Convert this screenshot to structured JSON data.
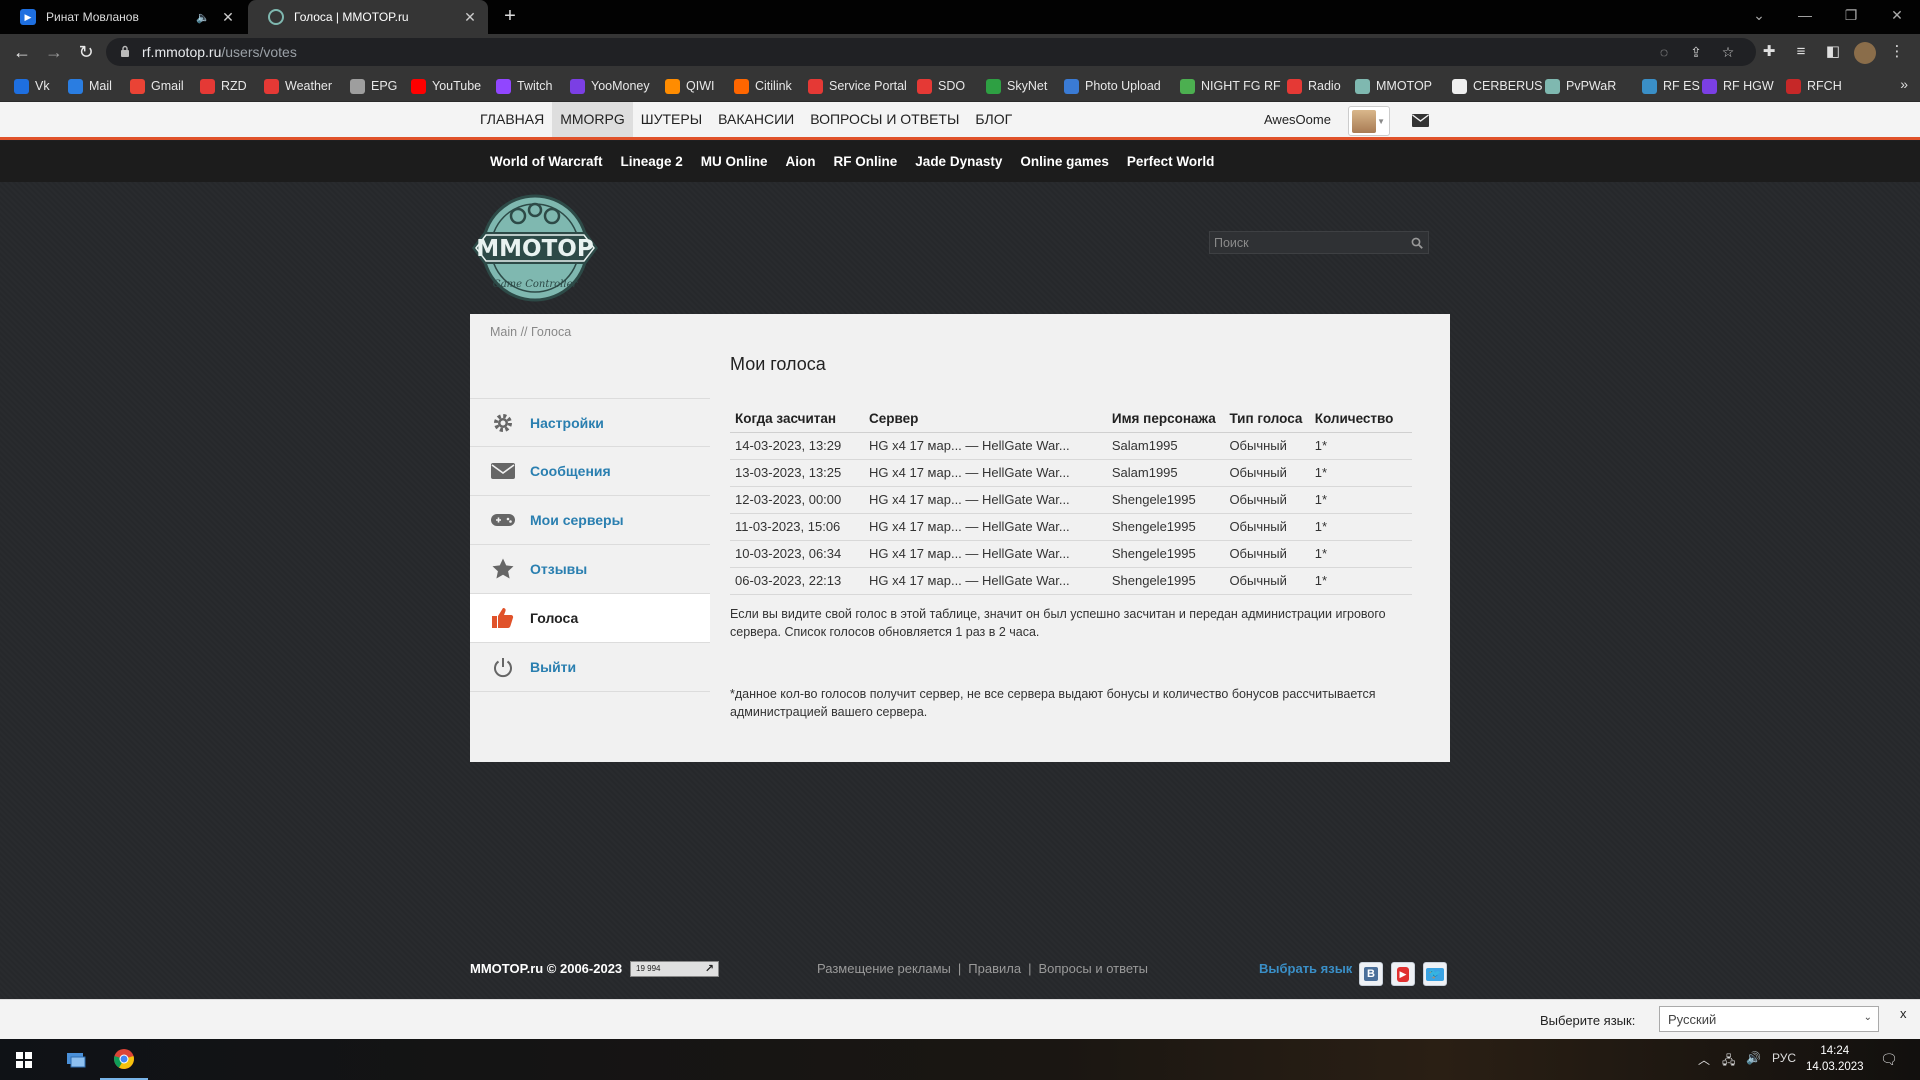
{
  "browser": {
    "tabs": [
      {
        "title": "Ринат Мовланов",
        "active": false,
        "muted": true
      },
      {
        "title": "Голоса | MMOTOP.ru",
        "active": true
      }
    ],
    "url_host": "rf.mmotop.ru",
    "url_path": "/users/votes",
    "bookmarks": [
      "Vk",
      "Mail",
      "Gmail",
      "RZD",
      "Weather",
      "EPG",
      "YouTube",
      "Twitch",
      "YooMoney",
      "QIWI",
      "Citilink",
      "Service Portal",
      "SDO",
      "SkyNet",
      "Photo Upload",
      "NIGHT FG RF",
      "Radio",
      "MMOTOP",
      "CERBERUS",
      "PvPWaR",
      "RF ES",
      "RF HGW",
      "RFCH"
    ],
    "bookmark_colors": [
      "#1e6fe0",
      "#2a7de1",
      "#ea4335",
      "#e53935",
      "#e53935",
      "#9e9e9e",
      "#ff0000",
      "#9146ff",
      "#7b3fe4",
      "#ff8c00",
      "#ff6600",
      "#e53935",
      "#e53935",
      "#2ea043",
      "#3a7bd5",
      "#4caf50",
      "#e53935",
      "#7fb8b0",
      "#eeeeee",
      "#7fb8b0",
      "#3a8fc7",
      "#7b3fe4",
      "#c62828"
    ]
  },
  "site": {
    "main_nav": [
      "ГЛАВНАЯ",
      "MMORPG",
      "ШУТЕРЫ",
      "ВАКАНСИИ",
      "ВОПРОСЫ И ОТВЕТЫ",
      "БЛОГ"
    ],
    "active_nav": "MMORPG",
    "username": "AwesOome",
    "sub_nav": [
      "World of Warcraft",
      "Lineage 2",
      "MU Online",
      "Aion",
      "RF Online",
      "Jade Dynasty",
      "Online games",
      "Perfect World"
    ],
    "logo_text": "MMOTOP",
    "logo_sub": "Game Controller",
    "search_placeholder": "Поиск",
    "accent_color": "#e0522a",
    "link_color": "#2a7fb0"
  },
  "breadcrumb": "Main // Голоса",
  "sidebar": [
    {
      "label": "Настройки",
      "icon": "gear-icon",
      "active": false
    },
    {
      "label": "Сообщения",
      "icon": "envelope-icon",
      "active": false
    },
    {
      "label": "Мои серверы",
      "icon": "gamepad-icon",
      "active": false
    },
    {
      "label": "Отзывы",
      "icon": "star-icon",
      "active": false
    },
    {
      "label": "Голоса",
      "icon": "thumbs-up-icon",
      "active": true
    },
    {
      "label": "Выйти",
      "icon": "power-icon",
      "active": false
    }
  ],
  "votes": {
    "title": "Мои голоса",
    "columns": [
      "Когда засчитан",
      "Сервер",
      "Имя персонажа",
      "Тип голоса",
      "Количество"
    ],
    "rows": [
      [
        "14-03-2023, 13:29",
        "HG x4 17 мар... — HellGate War...",
        "Salam1995",
        "Обычный",
        "1*"
      ],
      [
        "13-03-2023, 13:25",
        "HG x4 17 мар... — HellGate War...",
        "Salam1995",
        "Обычный",
        "1*"
      ],
      [
        "12-03-2023, 00:00",
        "HG x4 17 мар... — HellGate War...",
        "Shengele1995",
        "Обычный",
        "1*"
      ],
      [
        "11-03-2023, 15:06",
        "HG x4 17 мар... — HellGate War...",
        "Shengele1995",
        "Обычный",
        "1*"
      ],
      [
        "10-03-2023, 06:34",
        "HG x4 17 мар... — HellGate War...",
        "Shengele1995",
        "Обычный",
        "1*"
      ],
      [
        "06-03-2023, 22:13",
        "HG x4 17 мар... — HellGate War...",
        "Shengele1995",
        "Обычный",
        "1*"
      ]
    ],
    "note": "Если вы видите свой голос в этой таблице, значит он был успешно засчитан и передан администрации игрового сервера. Список голосов обновляется 1 раз в 2 часа.",
    "footnote": "*данное кол-во голосов получит сервер, не все сервера выдают бонусы и количество бонусов рассчитывается администрацией вашего сервера."
  },
  "footer": {
    "copyright": "MMOTOP.ru © 2006-2023",
    "counter": "19 994",
    "links": [
      "Размещение рекламы",
      "Правила",
      "Вопросы и ответы"
    ],
    "separator": "|",
    "language_link": "Выбрать язык"
  },
  "translate_bar": {
    "label": "Выберите язык:",
    "selected": "Русский",
    "close": "x"
  },
  "taskbar": {
    "lang": "РУС",
    "time": "14:24",
    "date": "14.03.2023"
  }
}
